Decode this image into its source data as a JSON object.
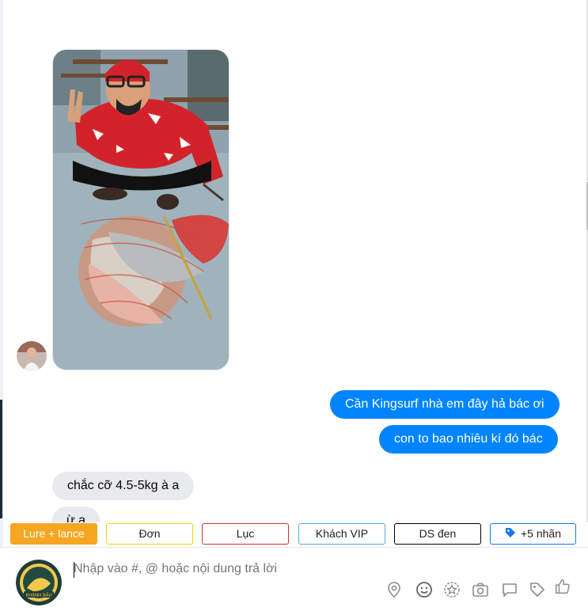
{
  "chat": {
    "messages_out": [
      "Cần Kingsurf nhà em đây hả bác ơi",
      "con to bao nhiêu kí đó bác"
    ],
    "messages_in": [
      "chắc cỡ 4.5-5kg à a",
      "ừ a"
    ]
  },
  "tags": [
    {
      "label": "Lure + lance",
      "color": "#f5a623"
    },
    {
      "label": "Đơn",
      "color": "#f2d600"
    },
    {
      "label": "Lục",
      "color": "#d32f2f"
    },
    {
      "label": "Khách VIP",
      "color": "#5aa7e6"
    },
    {
      "label": "DS đen",
      "color": "#000000"
    },
    {
      "label": "+5 nhãn",
      "color": "#1877f2",
      "icon": "tag-icon"
    }
  ],
  "composer": {
    "placeholder": "Nhập vào #, @ hoặc nội dung trả lời",
    "page_logo_text": "KHÁNH BẦU",
    "tools": [
      "location-icon",
      "emoji-icon",
      "sticker-icon",
      "camera-icon",
      "comment-icon",
      "tag-icon",
      "like-icon"
    ]
  },
  "colors": {
    "outgoing_bubble": "#0084ff",
    "incoming_bubble": "#e9eaed",
    "accent": "#1877f2"
  }
}
